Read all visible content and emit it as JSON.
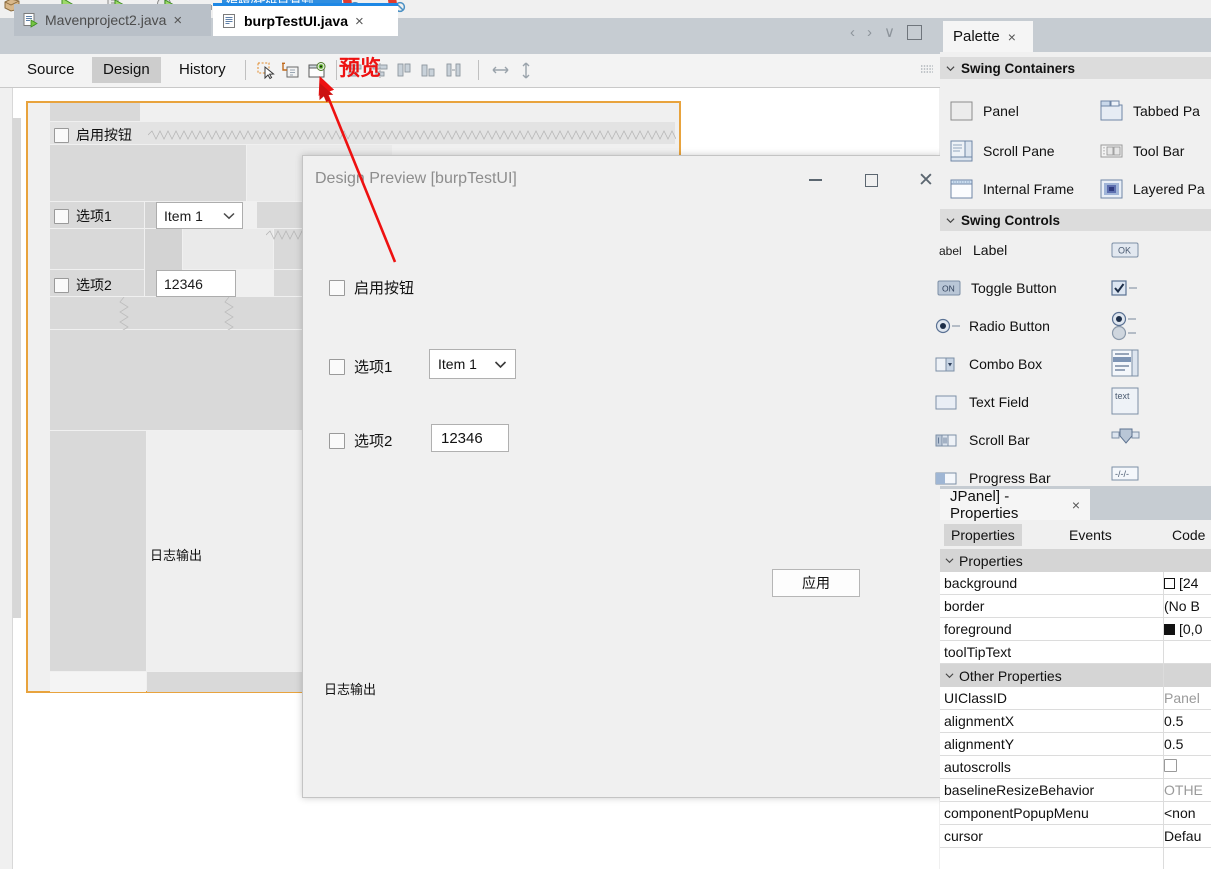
{
  "app_toolbar": {
    "highlight_label": "编辑/代码已复制",
    "icons": [
      "open-file-icon",
      "run-icon",
      "debug-file-icon",
      "profile-icon",
      "separator-dot",
      "stop-icon",
      "stop-alt-icon"
    ]
  },
  "editor_tabs": [
    {
      "label": "Mavenproject2.java",
      "active": false,
      "close": "×",
      "icon": "java-class-icon"
    },
    {
      "label": "burpTestUI.java",
      "active": true,
      "close": "×",
      "icon": "java-form-icon"
    }
  ],
  "tab_nav": {
    "back": "‹",
    "forward": "›",
    "dropdown": "∨",
    "maximize": "maximize-icon"
  },
  "design_toolbar": {
    "modes": [
      {
        "label": "Source",
        "selected": false
      },
      {
        "label": "Design",
        "selected": true
      },
      {
        "label": "History",
        "selected": false
      }
    ],
    "icons": [
      "selection-mode-icon",
      "connection-mode-icon",
      "preview-design-icon",
      "align-left-icon",
      "align-center-icon",
      "align-top-icon",
      "align-bottom-icon",
      "space-horizontal-icon",
      "resize-horizontal-icon",
      "resize-vertical-icon"
    ],
    "annotation": "预览"
  },
  "canvas": {
    "checkbox_enable": "启用按钮",
    "checkbox_opt1": "选项1",
    "checkbox_opt2": "选项2",
    "combo_value": "Item 1",
    "textfield_value": "12346",
    "log_label": "日志输出"
  },
  "dialog": {
    "title": "Design Preview [burpTestUI]",
    "minimize": "minimize-icon",
    "maximize": "maximize-icon",
    "close": "close-icon",
    "checkbox_enable": "启用按钮",
    "checkbox_opt1": "选项1",
    "checkbox_opt2": "选项2",
    "combo_value": "Item 1",
    "combo_caret": "∨",
    "textfield_value": "12346",
    "apply_button": "应用",
    "log_label": "日志输出"
  },
  "palette": {
    "tab_title": "Palette",
    "tab_close": "×",
    "sections": [
      {
        "title": "Swing Containers",
        "items": [
          {
            "label": "Panel",
            "icon": "panel-icon"
          },
          {
            "label": "Tabbed Pa",
            "icon": "tabbed-pane-icon"
          },
          {
            "label": "Scroll Pane",
            "icon": "scroll-pane-icon"
          },
          {
            "label": "Tool Bar",
            "icon": "tool-bar-icon"
          },
          {
            "label": "Internal Frame",
            "icon": "internal-frame-icon"
          },
          {
            "label": "Layered Pa",
            "icon": "layered-pane-icon"
          }
        ]
      },
      {
        "title": "Swing Controls",
        "items": [
          {
            "label": "Label",
            "icon": "label-icon"
          },
          {
            "label": "",
            "icon": "button-icon"
          },
          {
            "label": "Toggle Button",
            "icon": "toggle-button-icon"
          },
          {
            "label": "",
            "icon": "check-box-icon"
          },
          {
            "label": "Radio Button",
            "icon": "radio-button-icon"
          },
          {
            "label": "",
            "icon": "button-group-icon"
          },
          {
            "label": "Combo Box",
            "icon": "combo-box-icon"
          },
          {
            "label": "",
            "icon": "list-icon"
          },
          {
            "label": "Text Field",
            "icon": "text-field-icon"
          },
          {
            "label": "",
            "icon": "text-area-icon"
          },
          {
            "label": "Scroll Bar",
            "icon": "scroll-bar-icon"
          },
          {
            "label": "",
            "icon": "slider-icon"
          },
          {
            "label": "Progress Bar",
            "icon": "progress-bar-icon"
          },
          {
            "label": "",
            "icon": "formatted-field-icon"
          }
        ]
      }
    ]
  },
  "properties": {
    "tab_title": "JPanel] - Properties",
    "tab_close": "×",
    "tabs": [
      {
        "label": "Properties",
        "selected": true
      },
      {
        "label": "Events",
        "selected": false
      },
      {
        "label": "Code",
        "selected": false
      }
    ],
    "section_properties": "Properties",
    "section_other": "Other Properties",
    "rows": [
      {
        "name": "background",
        "value": "[24",
        "swatch": "open",
        "grayed": false
      },
      {
        "name": "border",
        "value": "(No B",
        "swatch": "none",
        "grayed": false
      },
      {
        "name": "foreground",
        "value": "[0,0",
        "swatch": "filled",
        "grayed": false
      },
      {
        "name": "toolTipText",
        "value": "",
        "swatch": "none",
        "grayed": false
      }
    ],
    "other_rows": [
      {
        "name": "UIClassID",
        "value": "Panel",
        "swatch": "none",
        "grayed": true
      },
      {
        "name": "alignmentX",
        "value": "0.5",
        "swatch": "none",
        "grayed": false
      },
      {
        "name": "alignmentY",
        "value": "0.5",
        "swatch": "none",
        "grayed": false
      },
      {
        "name": "autoscrolls",
        "value": "",
        "swatch": "checkbox",
        "grayed": false
      },
      {
        "name": "baselineResizeBehavior",
        "value": "OTHE",
        "swatch": "none",
        "grayed": true
      },
      {
        "name": "componentPopupMenu",
        "value": "<non",
        "swatch": "none",
        "grayed": false
      },
      {
        "name": "cursor",
        "value": "Defau",
        "swatch": "none",
        "grayed": false
      }
    ]
  },
  "colors": {
    "accent_blue": "#1e88e5",
    "annotation_red": "#ee1111",
    "form_border_orange": "#e8a33d",
    "tabbar_gray": "#c6ccd2",
    "panel_bg": "#f0f0f0"
  }
}
